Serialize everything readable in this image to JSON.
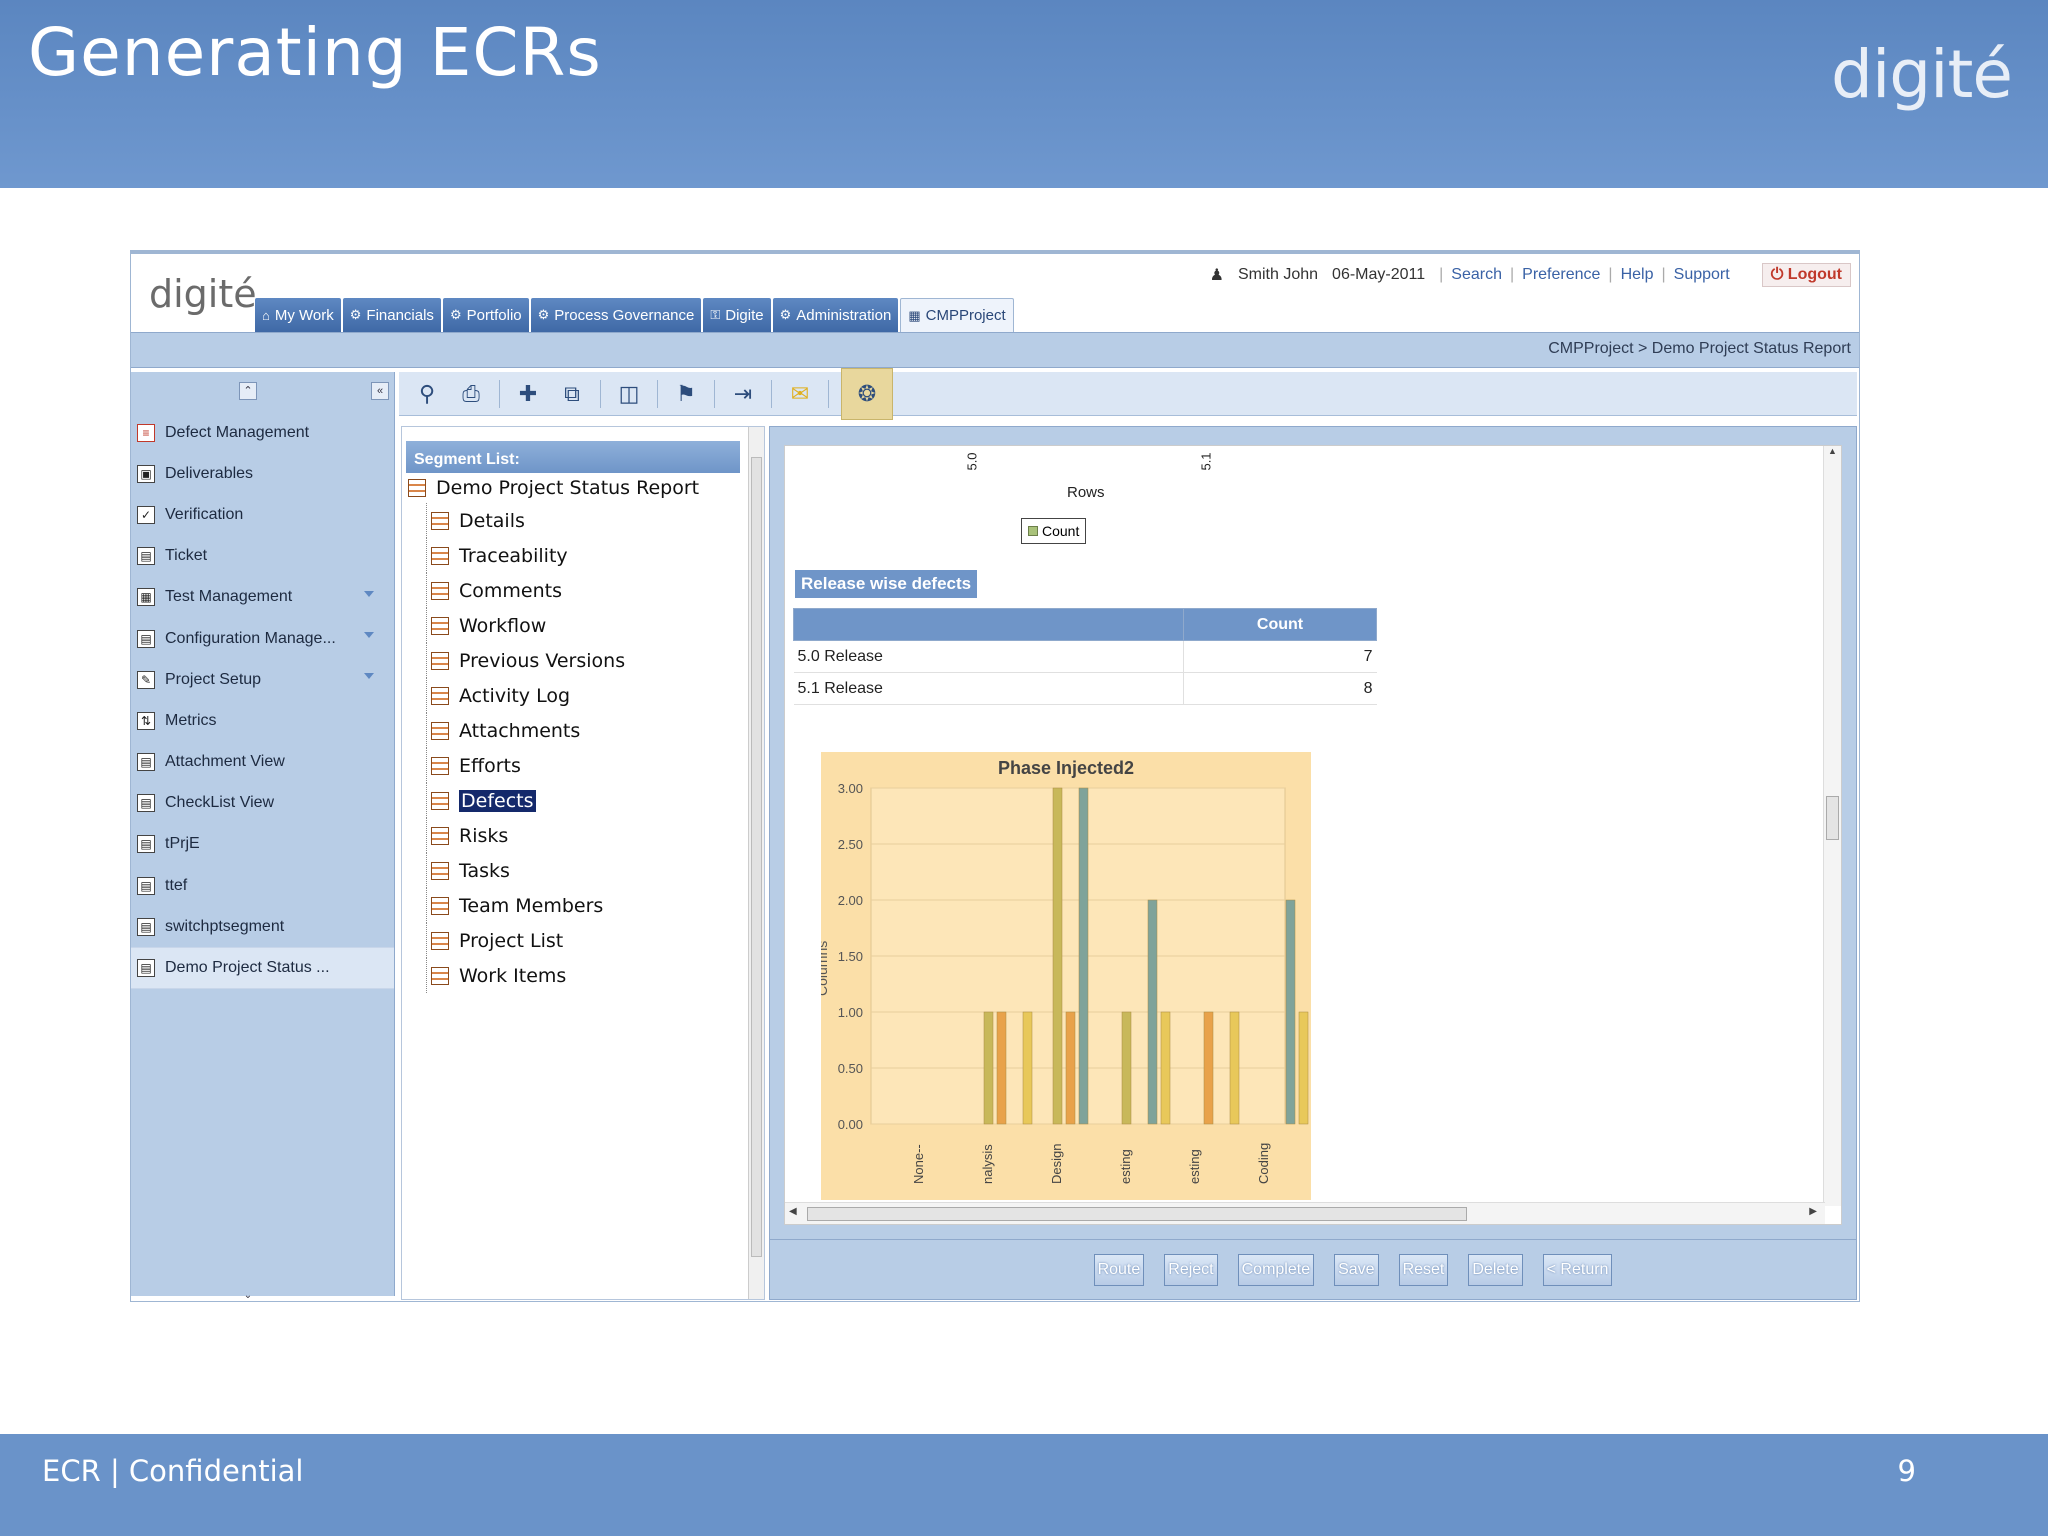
{
  "slide": {
    "title": "Generating ECRs",
    "brand": "digité",
    "footer": "ECR |  Confidential",
    "page_number": "9"
  },
  "app": {
    "logo": "digité",
    "user": "Smith John",
    "date": "06-May-2011",
    "links": [
      "Search",
      "Preference",
      "Help",
      "Support"
    ],
    "logout": "Logout",
    "tabs": [
      {
        "label": "My Work",
        "icon": "home-icon"
      },
      {
        "label": "Financials",
        "icon": "gear-icon"
      },
      {
        "label": "Portfolio",
        "icon": "gear-icon"
      },
      {
        "label": "Process Governance",
        "icon": "gear-icon"
      },
      {
        "label": "Digite",
        "icon": "lock-icon"
      },
      {
        "label": "Administration",
        "icon": "gear-icon"
      },
      {
        "label": "CMPProject",
        "icon": "project-icon"
      }
    ],
    "breadcrumb": "CMPProject > Demo Project Status Report"
  },
  "sidebar": {
    "items": [
      {
        "label": "Defect Management",
        "icon": "defect-icon"
      },
      {
        "label": "Deliverables",
        "icon": "deliverable-icon"
      },
      {
        "label": "Verification",
        "icon": "verification-icon"
      },
      {
        "label": "Ticket",
        "icon": "ticket-icon"
      },
      {
        "label": "Test Management",
        "icon": "test-icon",
        "expandable": true
      },
      {
        "label": "Configuration Manage...",
        "icon": "config-icon",
        "expandable": true
      },
      {
        "label": "Project Setup",
        "icon": "setup-icon",
        "expandable": true
      },
      {
        "label": "Metrics",
        "icon": "metrics-icon"
      },
      {
        "label": "Attachment View",
        "icon": "view-icon"
      },
      {
        "label": "CheckList View",
        "icon": "view-icon"
      },
      {
        "label": "tPrjE",
        "icon": "view-icon"
      },
      {
        "label": "ttef",
        "icon": "view-icon"
      },
      {
        "label": "switchptsegment",
        "icon": "view-icon"
      },
      {
        "label": "Demo Project Status ...",
        "icon": "view-icon",
        "active": true
      }
    ]
  },
  "segments": {
    "heading": "Segment List:",
    "root": "Demo Project Status Report",
    "items": [
      "Details",
      "Traceability",
      "Comments",
      "Workflow",
      "Previous Versions",
      "Activity Log",
      "Attachments",
      "Efforts",
      "Defects",
      "Risks",
      "Tasks",
      "Team Members",
      "Project List",
      "Work Items"
    ],
    "selected": "Defects"
  },
  "report": {
    "top_axis_labels": [
      "5.0",
      "5.1"
    ],
    "rows_label": "Rows",
    "legend_label": "Count",
    "table_title": "Release wise defects",
    "table_header": [
      "",
      "Count"
    ],
    "table_rows": [
      {
        "label": "5.0 Release",
        "count": "7"
      },
      {
        "label": "5.1 Release",
        "count": "8"
      }
    ]
  },
  "chart_data": {
    "type": "bar",
    "title": "Phase Injected2",
    "ylabel": "Columns",
    "xlabel": "",
    "ylim": [
      0,
      3
    ],
    "yticks": [
      "0.00",
      "0.50",
      "1.00",
      "1.50",
      "2.00",
      "2.50",
      "3.00"
    ],
    "categories": [
      "None--",
      "Analysis",
      "Design",
      "Testing",
      "Testing",
      "Coding"
    ],
    "category_labels_shown": [
      "None--",
      "nalysis",
      "Design",
      "esting",
      "esting",
      "Coding"
    ],
    "series": [
      {
        "color": "#c8b85a",
        "values": [
          0,
          1,
          3,
          1,
          0,
          0
        ]
      },
      {
        "color": "#e8a24a",
        "values": [
          0,
          1,
          1,
          0,
          1,
          0
        ]
      },
      {
        "color": "#7fa39a",
        "values": [
          0,
          0,
          3,
          2,
          0,
          2
        ]
      },
      {
        "color": "#e8c85a",
        "values": [
          0,
          1,
          0,
          1,
          1,
          1
        ]
      }
    ],
    "grid": true,
    "plot_bg": "#fbdfa8"
  },
  "actions": [
    "Route",
    "Reject",
    "Complete",
    "Save",
    "Reset",
    "Delete",
    "< Return"
  ]
}
